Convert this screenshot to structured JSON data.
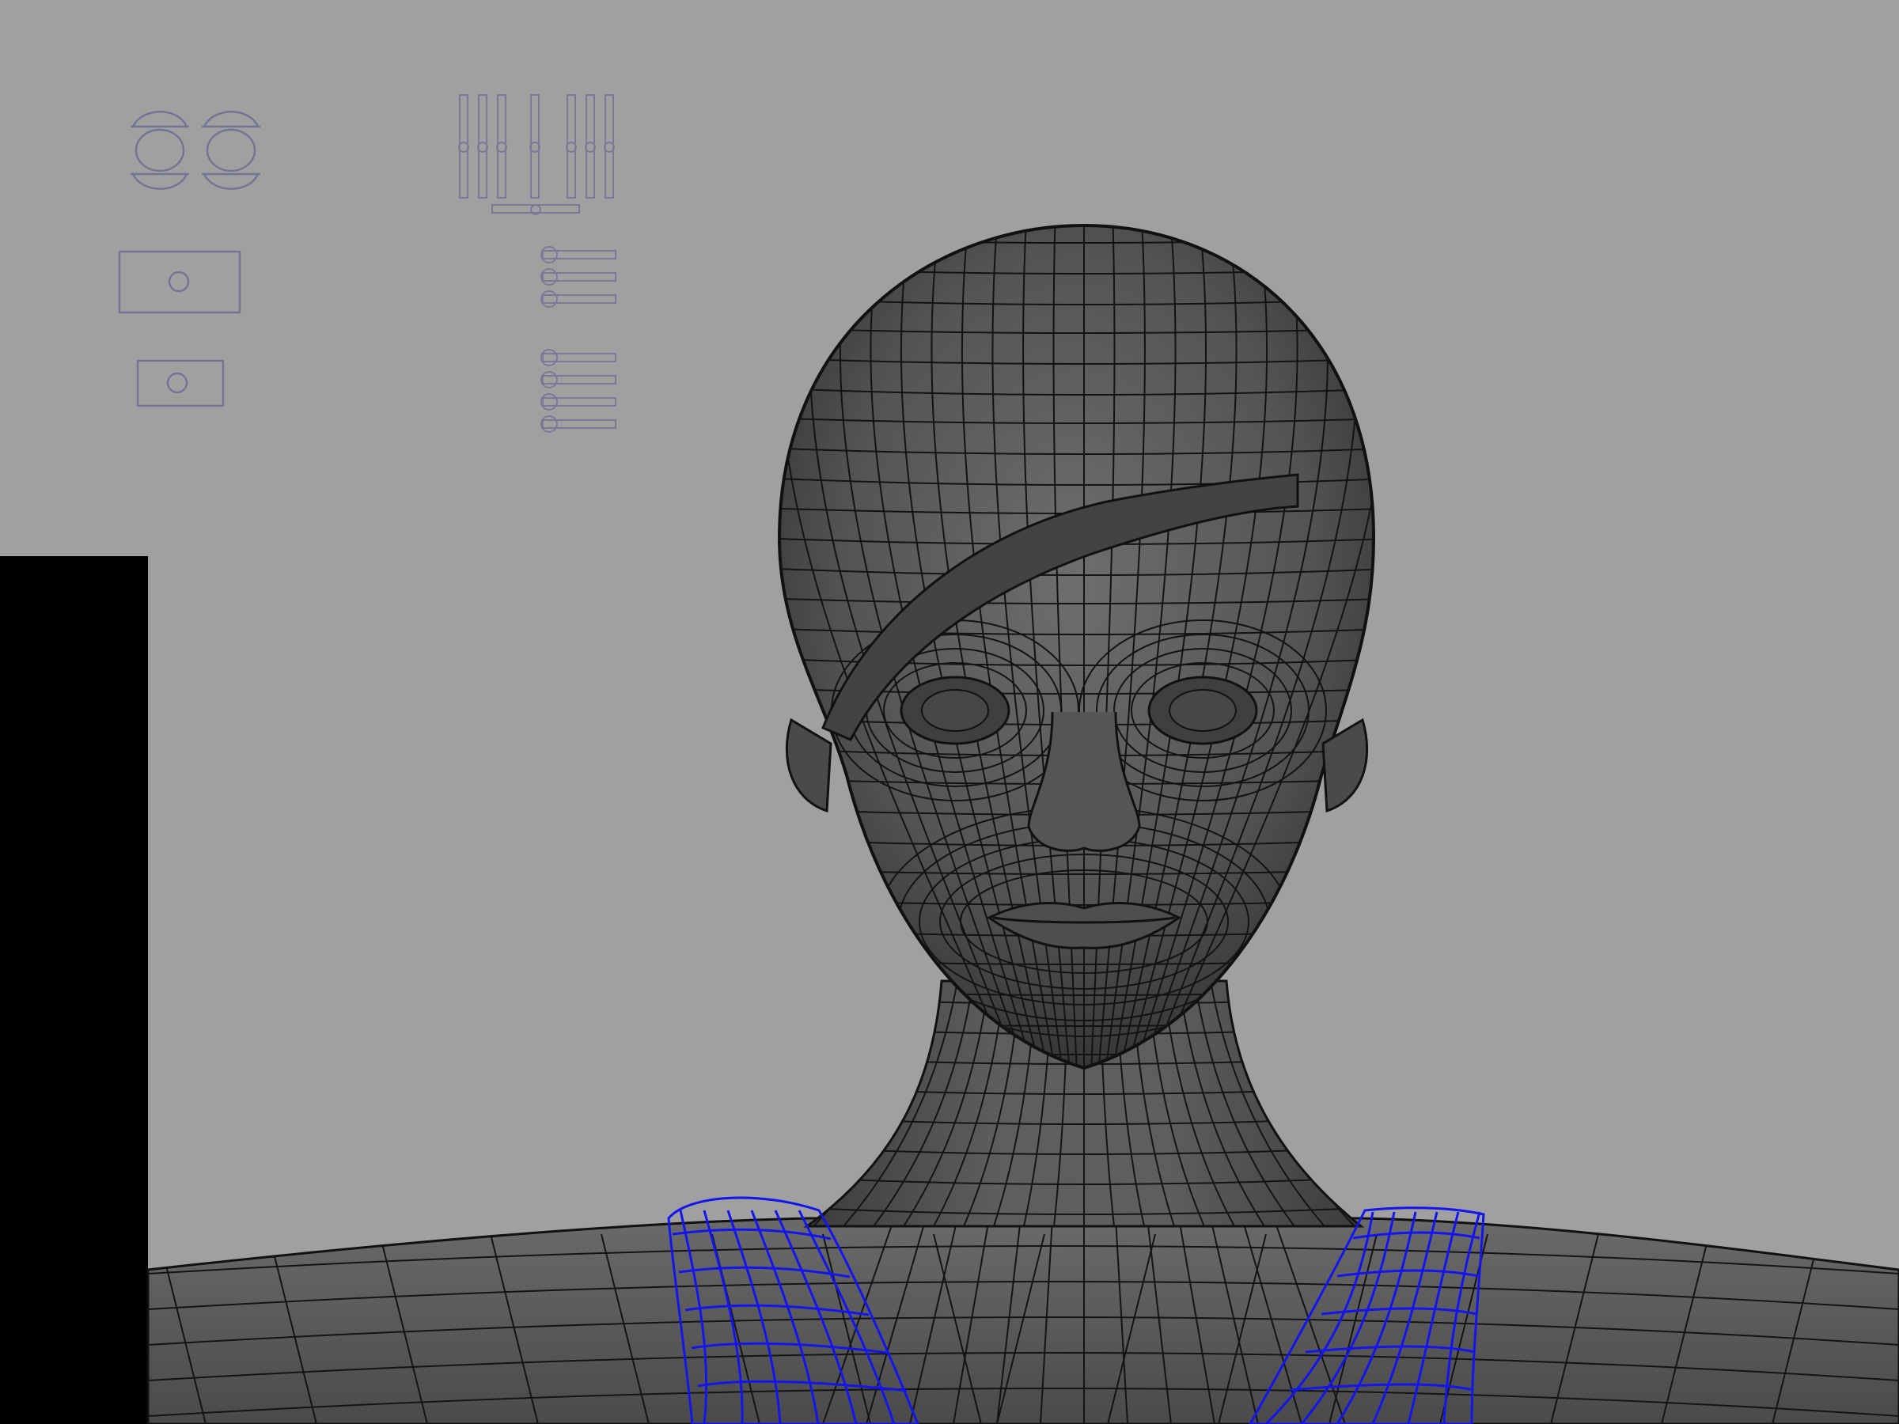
{
  "viewport": {
    "background_color": "#a0a0a0",
    "mesh_fill_color": "#5b5b5b",
    "mesh_dark_color": "#3a3a3a",
    "wire_color": "#0f0f0f",
    "selected_wire_color": "#1414ee",
    "control_curve_color": "#737394",
    "side_panel_color": "#000000"
  },
  "icons": {
    "eye_controls": "eye-control-icon",
    "jaw_control": "jaw-control-box-icon",
    "mouth_control": "mouth-control-box-icon",
    "sliders": "slider-control-icon",
    "selected_clavicle": "selected-wireframe-icon"
  },
  "rig": {
    "eye_control_count": 2,
    "vertical_slider_count": 7,
    "brow_slider_count": 3,
    "lip_slider_count": 4
  }
}
